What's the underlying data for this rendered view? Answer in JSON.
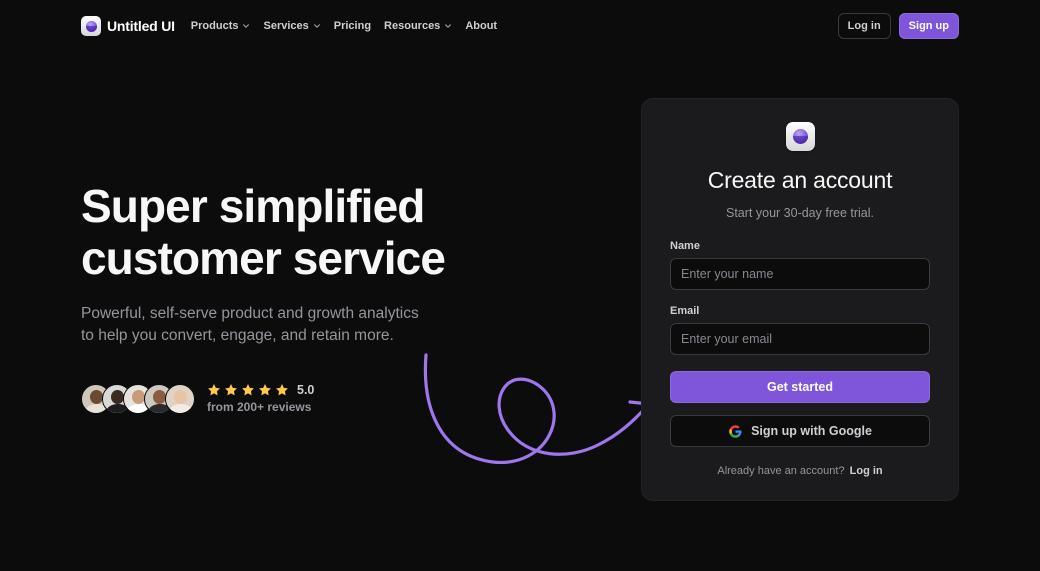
{
  "nav": {
    "brand": "Untitled UI",
    "links": [
      {
        "label": "Products",
        "dropdown": true
      },
      {
        "label": "Services",
        "dropdown": true
      },
      {
        "label": "Pricing",
        "dropdown": false
      },
      {
        "label": "Resources",
        "dropdown": true
      },
      {
        "label": "About",
        "dropdown": false
      }
    ],
    "login_label": "Log in",
    "signup_label": "Sign up"
  },
  "hero": {
    "headline_line1": "Super simplified",
    "headline_line2": "customer service",
    "sub_line1": "Powerful, self-serve product and growth analytics",
    "sub_line2": "to help you convert, engage, and retain more.",
    "rating_value": "5.0",
    "rating_stars": 5,
    "review_count": "from 200+ reviews"
  },
  "signup_card": {
    "title": "Create an account",
    "subtitle": "Start your 30-day free trial.",
    "name_label": "Name",
    "name_placeholder": "Enter your name",
    "name_value": "",
    "email_label": "Email",
    "email_placeholder": "Enter your email",
    "email_value": "",
    "primary_button": "Get started",
    "google_button": "Sign up with Google",
    "footer_text": "Already have an account?",
    "footer_link": "Log in"
  },
  "colors": {
    "background": "#0c0c0d",
    "card": "#1b1b1d",
    "accent": "#7f56d9",
    "star": "#fec84b",
    "arrow": "#9e77ed"
  },
  "icons": [
    "logo-icon",
    "chevron-down-icon",
    "star-icon",
    "google-icon",
    "curved-arrow-icon"
  ]
}
